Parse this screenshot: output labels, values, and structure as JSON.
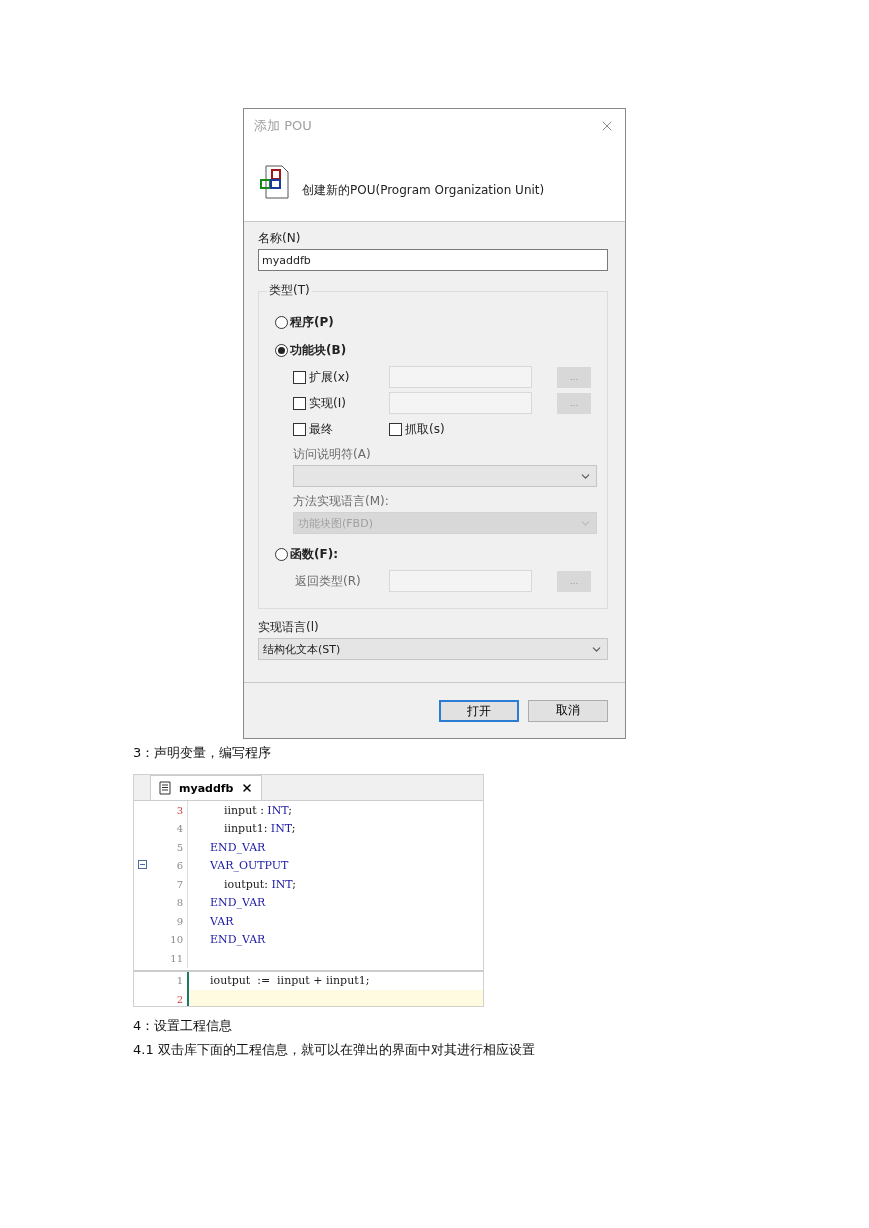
{
  "dialog": {
    "title": "添加 POU",
    "header": "创建新的POU(Program Organization Unit)",
    "name_label": "名称(N)",
    "name_value": "myaddfb",
    "type_group": {
      "legend": "类型(T)",
      "types": [
        {
          "kind": "program",
          "label": "程序(P)",
          "selected": false
        },
        {
          "kind": "function_block",
          "label": "功能块(B)",
          "selected": true,
          "options": [
            {
              "kind": "with_field",
              "label": "扩展(x)",
              "checked": false,
              "button": "..."
            },
            {
              "kind": "with_field",
              "label": "实现(I)",
              "checked": false,
              "button": "..."
            },
            {
              "kind": "pair",
              "items": [
                {
                  "label": "最终",
                  "checked": false
                },
                {
                  "label": "抓取(s)",
                  "checked": false
                }
              ]
            }
          ],
          "access_label": "访问说明符(A)",
          "access": {
            "disabled": false
          },
          "method_label": "方法实现语言(M):",
          "method": {
            "value": "功能块图(FBD)",
            "disabled": true
          }
        },
        {
          "kind": "function",
          "label": "函数(F):",
          "selected": false,
          "return_label": "返回类型(R)",
          "button": "..."
        }
      ]
    },
    "language_label": "实现语言(l)",
    "language": {
      "value": "结构化文本(ST)",
      "disabled": false
    },
    "buttons": [
      {
        "label": "打开",
        "default": true
      },
      {
        "label": "取消",
        "default": false
      }
    ]
  },
  "step3": "3：声明变量，编写程序",
  "editor": {
    "tab": "myaddfb",
    "declaration": [
      {
        "number": "3",
        "marked": true,
        "current": false,
        "tokens": [
          {
            "kind": "plain",
            "text": "    iinput : "
          },
          {
            "kind": "keyword",
            "text": "INT"
          },
          {
            "kind": "plain",
            "text": ";"
          }
        ]
      },
      {
        "number": "4",
        "marked": false,
        "current": false,
        "tokens": [
          {
            "kind": "plain",
            "text": "    iinput1: "
          },
          {
            "kind": "keyword",
            "text": "INT"
          },
          {
            "kind": "plain",
            "text": ";"
          }
        ]
      },
      {
        "number": "5",
        "marked": false,
        "current": false,
        "tokens": [
          {
            "kind": "keyword",
            "text": "END_VAR"
          }
        ]
      },
      {
        "number": "6",
        "marked": false,
        "fold": true,
        "current": false,
        "tokens": [
          {
            "kind": "keyword",
            "text": "VAR_OUTPUT"
          }
        ]
      },
      {
        "number": "7",
        "marked": false,
        "current": false,
        "tokens": [
          {
            "kind": "plain",
            "text": "    ioutput: "
          },
          {
            "kind": "keyword",
            "text": "INT"
          },
          {
            "kind": "plain",
            "text": ";"
          }
        ]
      },
      {
        "number": "8",
        "marked": false,
        "current": false,
        "tokens": [
          {
            "kind": "keyword",
            "text": "END_VAR"
          }
        ]
      },
      {
        "number": "9",
        "marked": false,
        "current": false,
        "tokens": [
          {
            "kind": "keyword",
            "text": "VAR"
          }
        ]
      },
      {
        "number": "10",
        "marked": false,
        "current": false,
        "tokens": [
          {
            "kind": "keyword",
            "text": "END_VAR"
          }
        ]
      },
      {
        "number": "11",
        "marked": false,
        "current": false
      }
    ],
    "body": [
      {
        "number": "1",
        "marked": false,
        "current": false,
        "tokens": [
          {
            "kind": "plain",
            "text": "ioutput  :=  iinput + iinput1;"
          }
        ]
      },
      {
        "number": "2",
        "marked": true,
        "current": true
      }
    ]
  },
  "step4": "4：设置工程信息",
  "step4_1": "4.1 双击库下面的工程信息，就可以在弹出的界面中对其进行相应设置"
}
